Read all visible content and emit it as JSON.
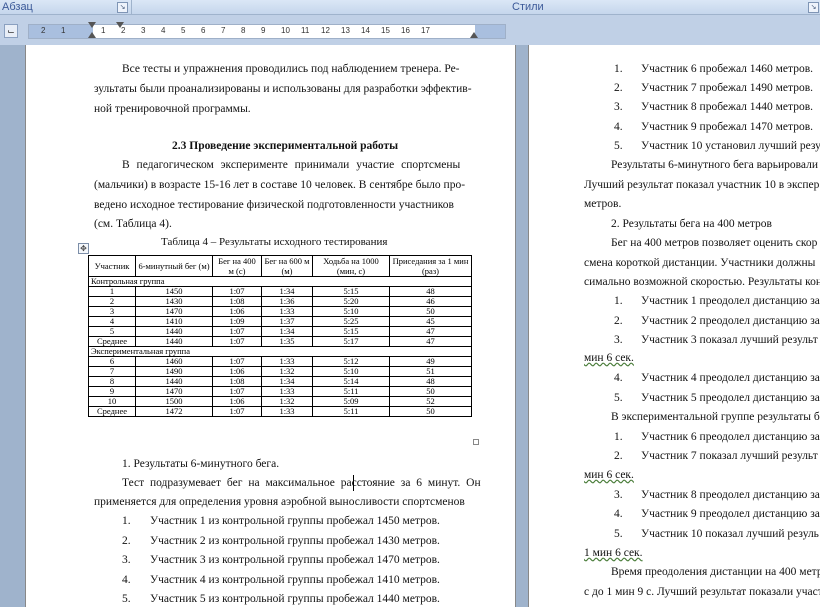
{
  "ribbon": {
    "paragraph_group": "Абзац",
    "styles_group": "Стили"
  },
  "ruler": {
    "ticks": [
      "2",
      "1",
      "1",
      "2",
      "3",
      "4",
      "5",
      "6",
      "7",
      "8",
      "9",
      "10",
      "11",
      "12",
      "13",
      "14",
      "15",
      "16",
      "17"
    ]
  },
  "page1": {
    "para1": [
      "Все тесты и упражнения проводились под наблюдением тренера. Ре-",
      "зультаты были проанализированы и использованы для разработки эффектив-",
      "ной тренировочной программы."
    ],
    "heading": "2.3 Проведение экспериментальной работы",
    "para2": [
      "В педагогическом эксперименте принимали участие спортсмены",
      "(мальчики) в возрасте 15-16 лет в составе 10 человек. В сентябре было про-",
      "ведено исходное тестирование физической подготовленности участников",
      "(см. Таблица 4)."
    ],
    "table_caption": "Таблица 4 – Результаты исходного тестирования",
    "table": {
      "headers": [
        "Участник",
        "6-минутный бег (м)",
        "Бег на 400 м (с)",
        "Бег на 600 м (м)",
        "Ходьба на 1000 (мин, с)",
        "Приседания за 1 мин (раз)"
      ],
      "control_label": "Контрольная группа",
      "control_rows": [
        [
          "1",
          "1450",
          "1:07",
          "1:34",
          "5:15",
          "48"
        ],
        [
          "2",
          "1430",
          "1:08",
          "1:36",
          "5:20",
          "46"
        ],
        [
          "3",
          "1470",
          "1:06",
          "1:33",
          "5:10",
          "50"
        ],
        [
          "4",
          "1410",
          "1:09",
          "1:37",
          "5:25",
          "45"
        ],
        [
          "5",
          "1440",
          "1:07",
          "1:34",
          "5:15",
          "47"
        ],
        [
          "Среднее",
          "1440",
          "1:07",
          "1:35",
          "5:17",
          "47"
        ]
      ],
      "exp_label": "Экспериментальная группа",
      "exp_rows": [
        [
          "6",
          "1460",
          "1:07",
          "1:33",
          "5:12",
          "49"
        ],
        [
          "7",
          "1490",
          "1:06",
          "1:32",
          "5:10",
          "51"
        ],
        [
          "8",
          "1440",
          "1:08",
          "1:34",
          "5:14",
          "48"
        ],
        [
          "9",
          "1470",
          "1:07",
          "1:33",
          "5:11",
          "50"
        ],
        [
          "10",
          "1500",
          "1:06",
          "1:32",
          "5:09",
          "52"
        ],
        [
          "Среднее",
          "1472",
          "1:07",
          "1:33",
          "5:11",
          "50"
        ]
      ]
    },
    "list_title": "1. Результаты 6-минутного бега.",
    "para3": [
      "Тест подразумевает бег на максимальное расстояние за 6 минут. Он",
      "применяется для определения уровня аэробной выносливости спортсменов"
    ],
    "list_items": [
      {
        "n": "1.",
        "t": "Участник 1 из контрольной группы пробежал 1450 метров."
      },
      {
        "n": "2.",
        "t": "Участник 2 из контрольной группы пробежал 1430 метров."
      },
      {
        "n": "3.",
        "t": "Участник 3 из контрольной группы пробежал 1470 метров."
      },
      {
        "n": "4.",
        "t": "Участник 4 из контрольной группы пробежал 1410 метров."
      },
      {
        "n": "5.",
        "t": "Участник 5 из контрольной группы пробежал 1440 метров."
      }
    ]
  },
  "page2": {
    "lines": [
      {
        "n": "1.",
        "t": "Участник 6 пробежал 1460 метров."
      },
      {
        "n": "2.",
        "t": "Участник 7 пробежал 1490 метров."
      },
      {
        "n": "3.",
        "t": "Участник 8 пробежал 1440 метров."
      },
      {
        "n": "4.",
        "t": "Участник 9 пробежал 1470 метров."
      },
      {
        "n": "5.",
        "t": "Участник 10 установил лучший резул"
      },
      {
        "n": "",
        "t": "Результаты 6-минутного бега варьировали"
      },
      {
        "n": "",
        "t": "Лучший результат показал участник 10 в экспер"
      },
      {
        "n": "",
        "t": "метров."
      },
      {
        "n": "",
        "t": "2. Результаты бега на 400 метров"
      },
      {
        "n": "",
        "t": "Бег на 400 метров позволяет оценить скор"
      },
      {
        "n": "",
        "t": "смена короткой дистанции. Участники должны"
      },
      {
        "n": "",
        "t": "симально возможной скоростью. Результаты кон"
      },
      {
        "n": "1.",
        "t": "Участник 1 преодолел дистанцию за"
      },
      {
        "n": "2.",
        "t": "Участник 2 преодолел дистанцию за"
      },
      {
        "n": "3.",
        "t": "Участник 3 показал лучший результ"
      },
      {
        "n": "",
        "t": "мин 6 сек."
      },
      {
        "n": "4.",
        "t": "Участник 4 преодолел дистанцию за"
      },
      {
        "n": "5.",
        "t": "Участник 5 преодолел дистанцию за"
      },
      {
        "n": "",
        "t": "В экспериментальной группе результаты б"
      },
      {
        "n": "1.",
        "t": "Участник 6 преодолел дистанцию за"
      },
      {
        "n": "2.",
        "t": "Участник 7 показал лучший результ"
      },
      {
        "n": "",
        "t": "мин 6 сек."
      },
      {
        "n": "3.",
        "t": "Участник 8 преодолел дистанцию за"
      },
      {
        "n": "4.",
        "t": "Участник 9 преодолел дистанцию за"
      },
      {
        "n": "5.",
        "t": "Участник 10 показал лучший резуль"
      },
      {
        "n": "",
        "t": "1 мин 6 сек."
      },
      {
        "n": "",
        "t": "Время преодоления дистанции на 400 метр"
      },
      {
        "n": "",
        "t": "с до 1 мин 9 с. Лучший результат показали участ"
      }
    ]
  }
}
